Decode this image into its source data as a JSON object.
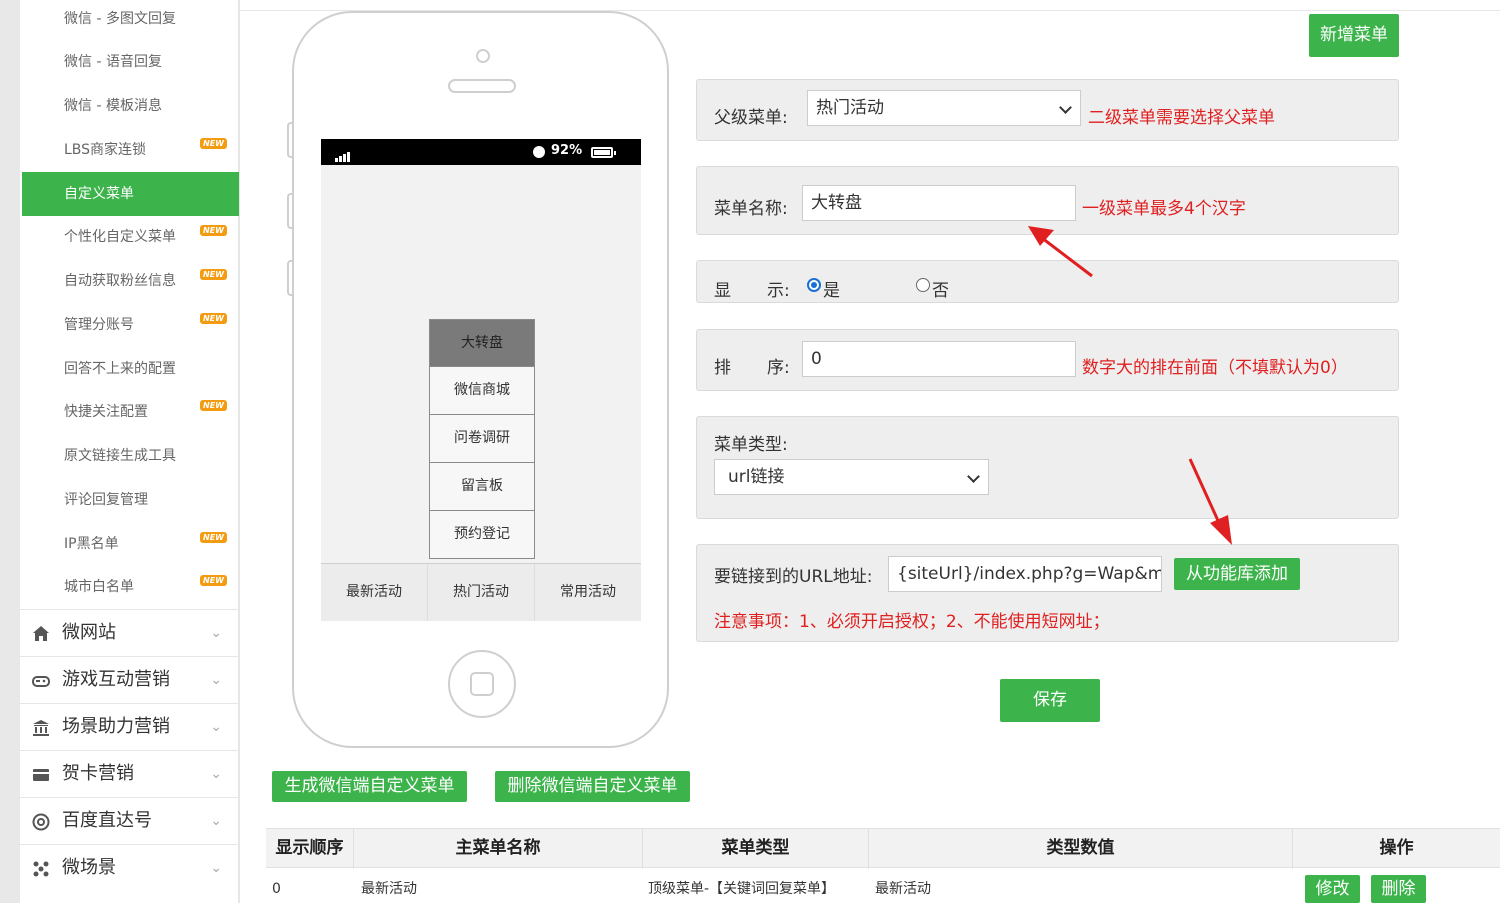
{
  "sidebar": {
    "sub_items": [
      {
        "label": "微信 - 多图文回复",
        "new": false,
        "active": false
      },
      {
        "label": "微信 - 语音回复",
        "new": false,
        "active": false
      },
      {
        "label": "微信 - 模板消息",
        "new": false,
        "active": false
      },
      {
        "label": "LBS商家连锁",
        "new": true,
        "active": false
      },
      {
        "label": "自定义菜单",
        "new": false,
        "active": true
      },
      {
        "label": "个性化自定义菜单",
        "new": true,
        "active": false
      },
      {
        "label": "自动获取粉丝信息",
        "new": true,
        "active": false
      },
      {
        "label": "管理分账号",
        "new": true,
        "active": false
      },
      {
        "label": "回答不上来的配置",
        "new": false,
        "active": false
      },
      {
        "label": "快捷关注配置",
        "new": true,
        "active": false
      },
      {
        "label": "原文链接生成工具",
        "new": false,
        "active": false
      },
      {
        "label": "评论回复管理",
        "new": false,
        "active": false
      },
      {
        "label": "IP黑名单",
        "new": true,
        "active": false
      },
      {
        "label": "城市白名单",
        "new": true,
        "active": false
      }
    ],
    "new_badge": "NEW",
    "main_items": [
      {
        "label": "微网站",
        "icon": "home-icon"
      },
      {
        "label": "游戏互动营销",
        "icon": "gamepad-icon"
      },
      {
        "label": "场景助力营销",
        "icon": "bank-icon"
      },
      {
        "label": "贺卡营销",
        "icon": "card-icon"
      },
      {
        "label": "百度直达号",
        "icon": "at-icon"
      },
      {
        "label": "微场景",
        "icon": "molecule-icon"
      }
    ]
  },
  "phone": {
    "battery": "92%",
    "submenu": [
      "大转盘",
      "微信商城",
      "问卷调研",
      "留言板",
      "预约登记"
    ],
    "tabs": [
      "最新活动",
      "热门活动",
      "常用活动"
    ]
  },
  "form": {
    "add_menu_button": "新增菜单",
    "parent_label": "父级菜单:",
    "parent_value": "热门活动",
    "parent_hint": "二级菜单需要选择父菜单",
    "name_label": "菜单名称:",
    "name_value": "大转盘",
    "name_hint": "一级菜单最多4个汉字",
    "show_label_1": "显",
    "show_label_2": "示:",
    "show_yes": "是",
    "show_no": "否",
    "order_label_1": "排",
    "order_label_2": "序:",
    "order_value": "0",
    "order_hint": "数字大的排在前面（不填默认为0）",
    "type_label": "菜单类型:",
    "type_value": "url链接",
    "url_label": "要链接到的URL地址:",
    "url_value": "{siteUrl}/index.php?g=Wap&m=Lo",
    "url_lib_button": "从功能库添加",
    "url_note": "注意事项：1、必须开启授权；2、不能使用短网址；",
    "save_button": "保存",
    "accent": "#3cb44b",
    "hint_color": "#e02020"
  },
  "actions": {
    "generate_button": "生成微信端自定义菜单",
    "delete_button": "删除微信端自定义菜单"
  },
  "table": {
    "headers": [
      "显示顺序",
      "主菜单名称",
      "菜单类型",
      "类型数值",
      "操作"
    ],
    "rows": [
      {
        "order": "0",
        "name": "最新活动",
        "type": "顶级菜单-【关键词回复菜单】",
        "value": "最新活动",
        "edit": "修改",
        "delete": "删除"
      }
    ]
  }
}
